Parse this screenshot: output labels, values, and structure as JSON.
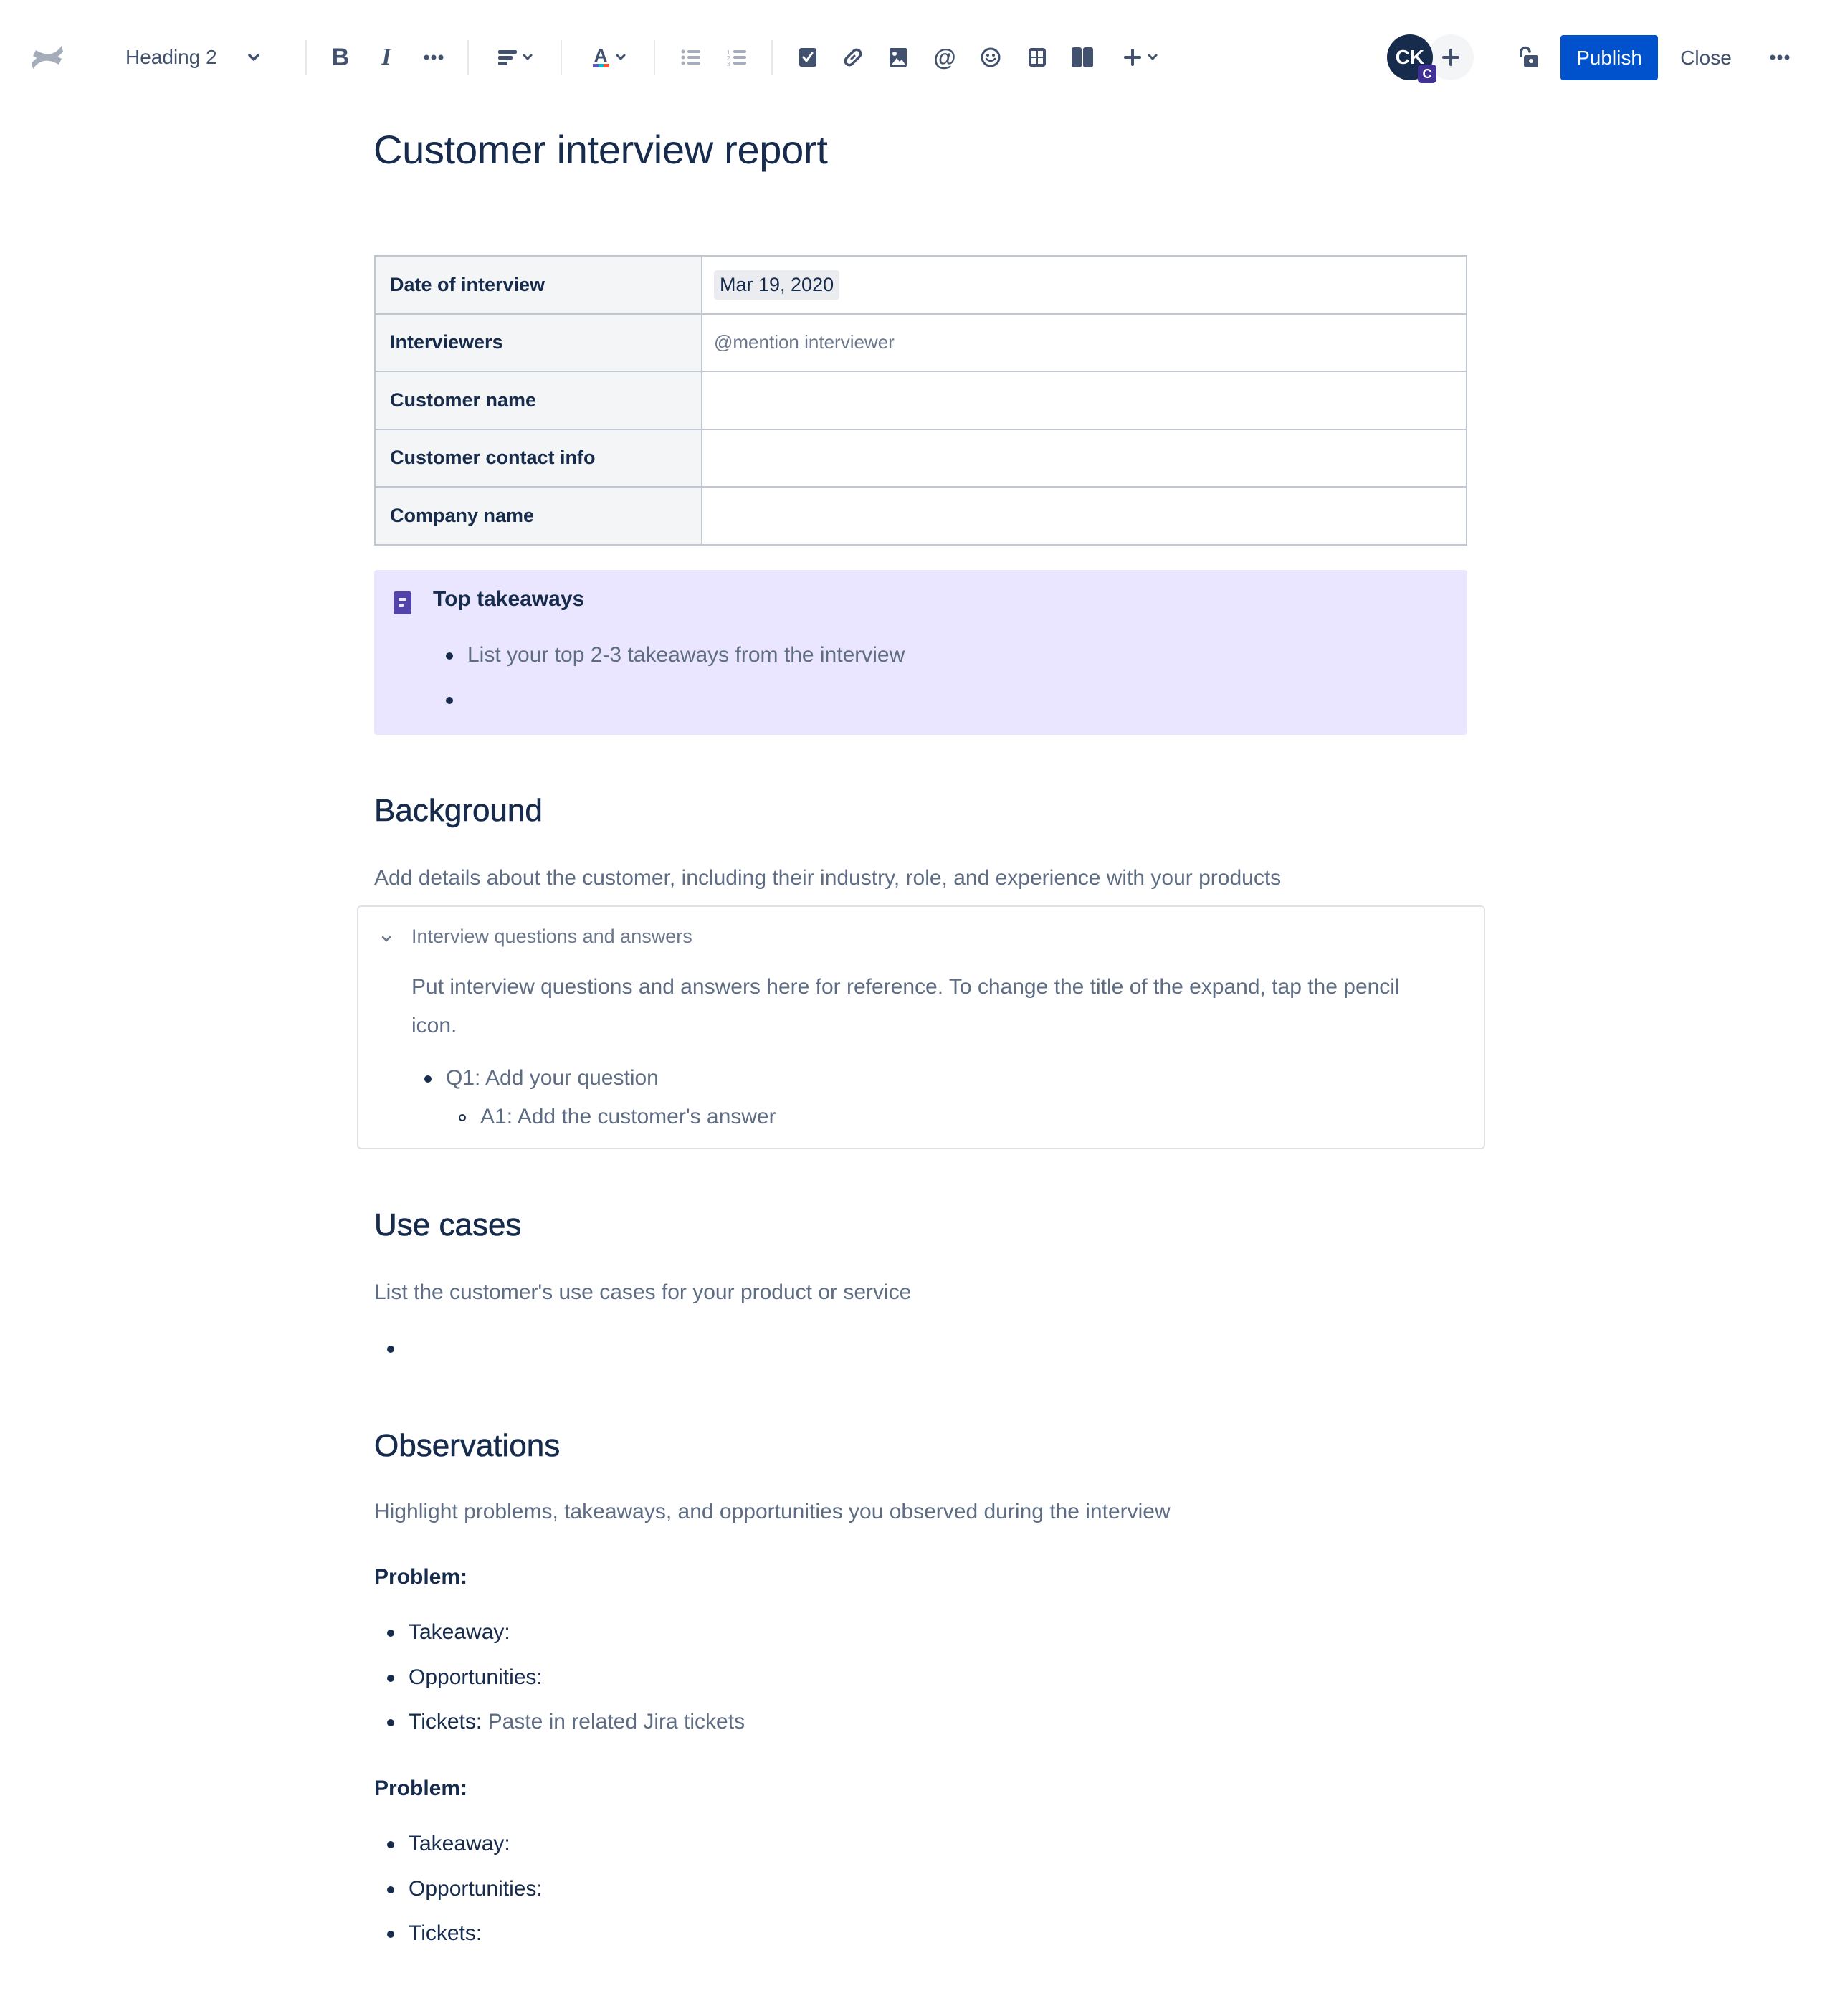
{
  "toolbar": {
    "logo": "confluence-logo",
    "text_style": "Heading 2",
    "icons": {
      "bold": "B",
      "italic": "I",
      "more_formatting": "more-icon",
      "align": "align-left-icon",
      "text_color": "text-color-icon",
      "bullet_list": "bullet-list-icon",
      "numbered_list": "numbered-list-icon",
      "action_item": "checkbox-icon",
      "link": "link-icon",
      "image": "image-icon",
      "mention": "@",
      "emoji": "emoji-icon",
      "table": "table-icon",
      "layout": "layout-icon",
      "insert": "plus-icon"
    },
    "avatar_initials": "CK",
    "avatar_badge": "C",
    "publish_label": "Publish",
    "close_label": "Close",
    "colors": {
      "publish": "#0052CC",
      "avatar": "#172B4D",
      "badge": "#403294"
    }
  },
  "page": {
    "title": "Customer interview report",
    "info_table": [
      {
        "label": "Date of interview",
        "value": "Mar 19, 2020",
        "type": "date"
      },
      {
        "label": "Interviewers",
        "value": "@mention interviewer",
        "type": "placeholder"
      },
      {
        "label": "Customer name",
        "value": ""
      },
      {
        "label": "Customer contact info",
        "value": ""
      },
      {
        "label": "Company name",
        "value": ""
      }
    ],
    "panel": {
      "title": "Top takeaways",
      "items": [
        "List your top 2-3 takeaways from the interview",
        ""
      ],
      "color": "#EAE6FF"
    },
    "background": {
      "heading": "Background",
      "text": "Add details about the customer, including their industry, role, and experience with your products",
      "expand": {
        "title": "Interview questions and answers",
        "body": "Put interview questions and answers here for reference. To change the title of the expand, tap the pencil icon.",
        "question": "Q1: Add your question",
        "answer": "A1: Add the customer's answer"
      }
    },
    "use_cases": {
      "heading": "Use cases",
      "text": "List the customer's use cases for your product or service",
      "items": [
        ""
      ]
    },
    "observations": {
      "heading": "Observations",
      "text": "Highlight problems, takeaways, and opportunities you observed during the interview",
      "problems": [
        {
          "label": "Problem:",
          "items": [
            {
              "label": "Takeaway:",
              "hint": ""
            },
            {
              "label": "Opportunities:",
              "hint": ""
            },
            {
              "label": "Tickets:",
              "hint": "Paste in related Jira tickets"
            }
          ]
        },
        {
          "label": "Problem:",
          "items": [
            {
              "label": "Takeaway:",
              "hint": ""
            },
            {
              "label": "Opportunities:",
              "hint": ""
            },
            {
              "label": "Tickets:",
              "hint": ""
            }
          ]
        }
      ]
    }
  }
}
